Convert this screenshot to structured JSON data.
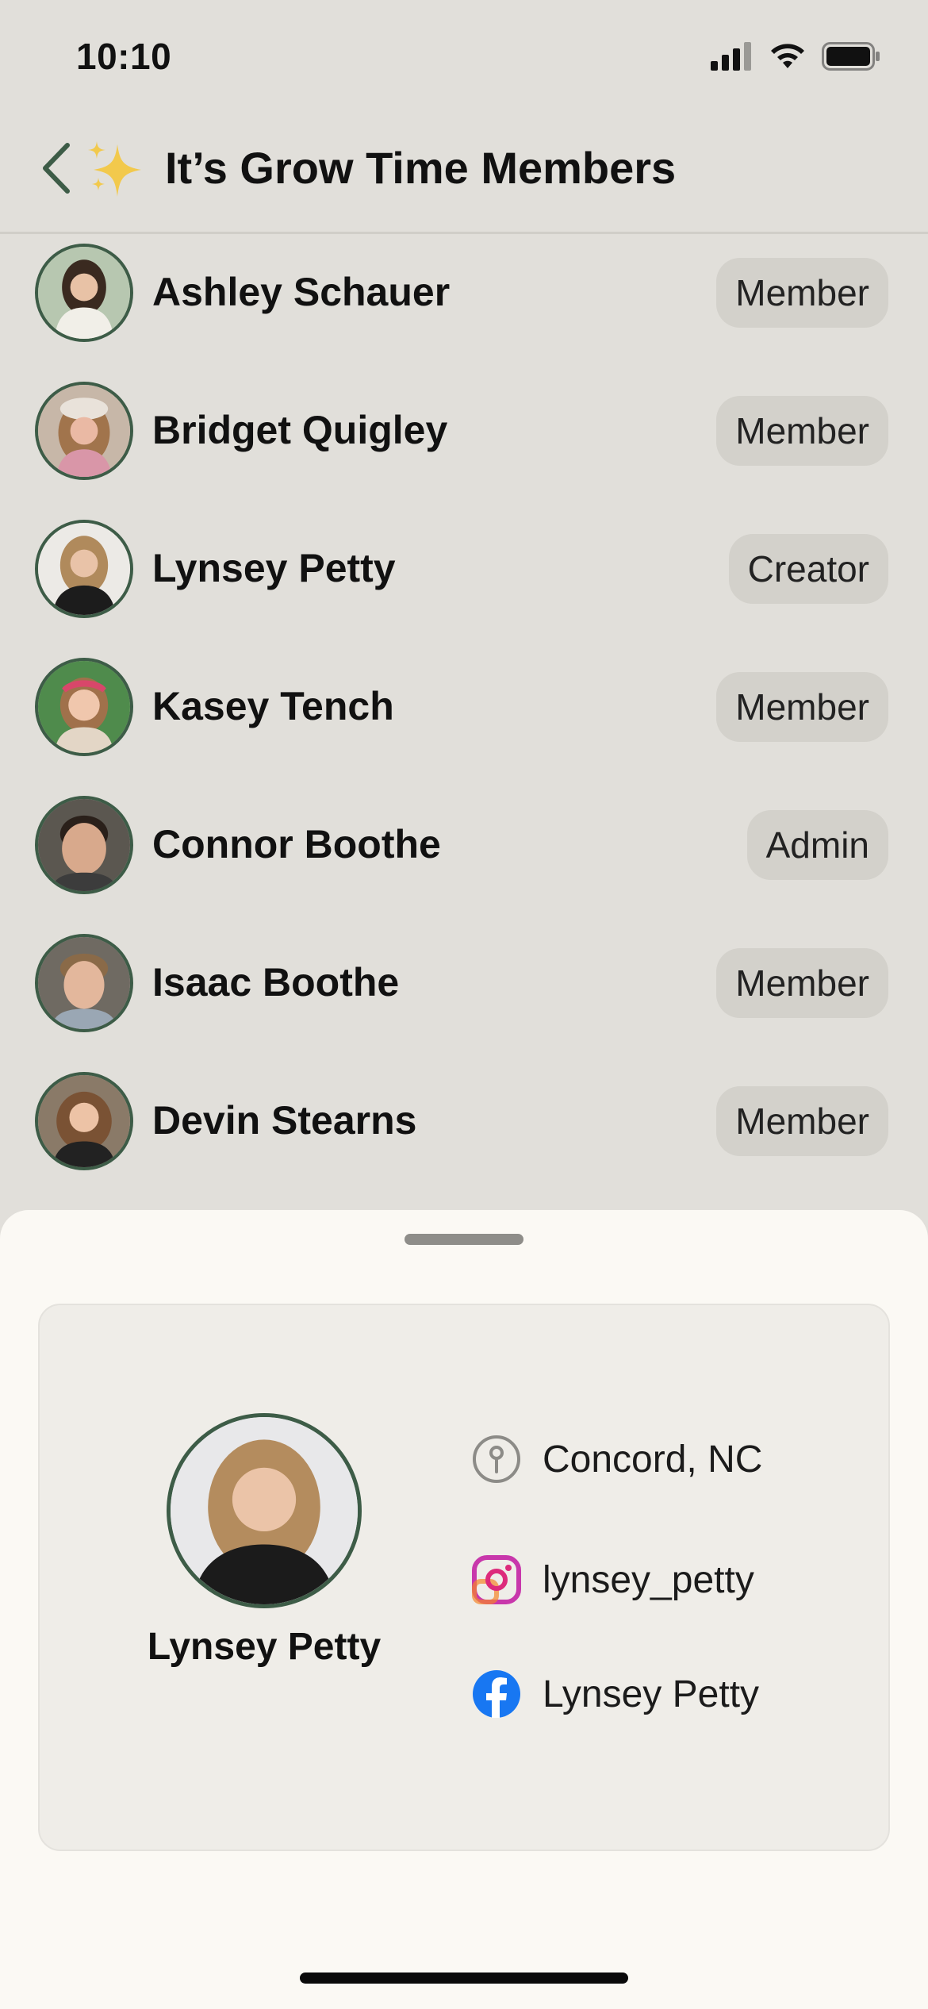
{
  "status_bar": {
    "time": "10:10",
    "icons": [
      "signal-icon",
      "wifi-icon",
      "battery-icon"
    ]
  },
  "header": {
    "title": "It’s Grow Time Members",
    "back_icon": "chevron-left-icon",
    "emoji_icon": "sparkles-icon"
  },
  "members": [
    {
      "name": "Ashley Schauer",
      "role": "Member"
    },
    {
      "name": "Bridget Quigley",
      "role": "Member"
    },
    {
      "name": "Lynsey Petty",
      "role": "Creator"
    },
    {
      "name": "Kasey Tench",
      "role": "Member"
    },
    {
      "name": "Connor Boothe",
      "role": "Admin"
    },
    {
      "name": "Isaac Boothe",
      "role": "Member"
    },
    {
      "name": "Devin Stearns",
      "role": "Member"
    }
  ],
  "profile_sheet": {
    "name": "Lynsey Petty",
    "location": "Concord, NC",
    "instagram": "lynsey_petty",
    "facebook": "Lynsey Petty"
  },
  "colors": {
    "background": "#e1dfda",
    "sheet": "#fbf9f4",
    "card": "#efede8",
    "badge": "#d3d1cb",
    "avatar_ring": "#3d5c47",
    "facebook_blue": "#1877f2"
  }
}
